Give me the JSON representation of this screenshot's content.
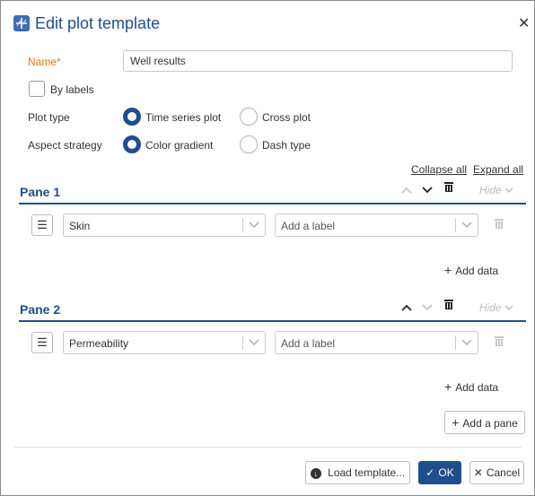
{
  "dialog": {
    "title": "Edit plot template",
    "close_icon": "close-icon",
    "app_icon": "plot-template-icon"
  },
  "form": {
    "name_label": "Name",
    "required_mark": "*",
    "name_value": "Well results",
    "by_labels_label": "By labels",
    "by_labels_checked": false,
    "plot_type_label": "Plot type",
    "plot_type_options": [
      "Time series plot",
      "Cross plot"
    ],
    "plot_type_selected": "Time series plot",
    "aspect_label": "Aspect strategy",
    "aspect_options": [
      "Color gradient",
      "Dash type"
    ],
    "aspect_selected": "Color gradient"
  },
  "links": {
    "collapse_all": "Collapse all",
    "expand_all": "Expand all"
  },
  "panes": [
    {
      "title": "Pane 1",
      "hide": "Hide",
      "row": {
        "data_value": "Skin",
        "label_placeholder": "Add a label"
      },
      "add_data": "Add data"
    },
    {
      "title": "Pane 2",
      "hide": "Hide",
      "row": {
        "data_value": "Permeability",
        "label_placeholder": "Add a label"
      },
      "add_data": "Add data"
    }
  ],
  "add_pane": "Add a pane",
  "footer": {
    "load_template": "Load template...",
    "ok": "OK",
    "cancel": "Cancel"
  },
  "colors": {
    "accent": "#1f4e8c",
    "required": "#e2761b"
  }
}
